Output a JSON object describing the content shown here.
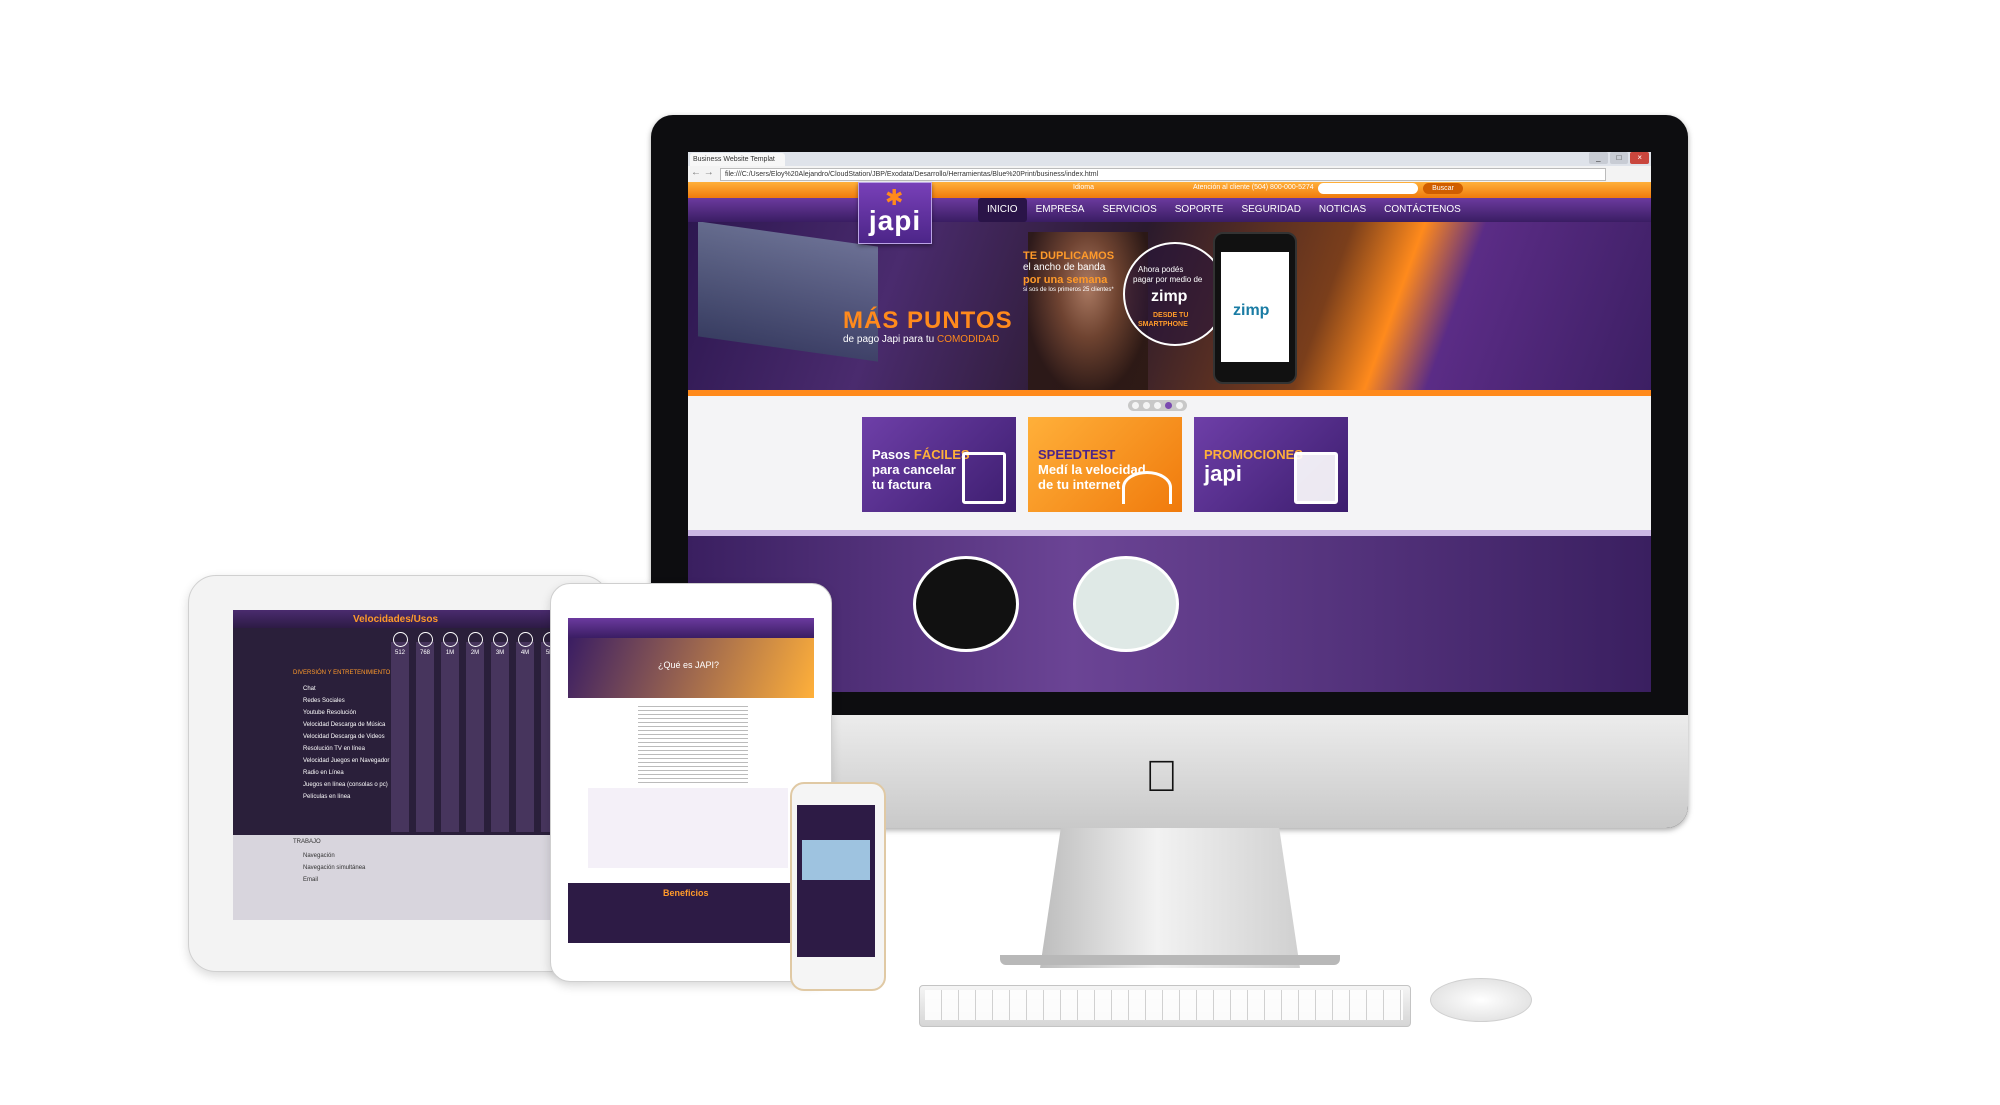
{
  "browser": {
    "tab_title": "Business Website Templat",
    "url": "file:///C:/Users/Eloy%20Alejandro/CloudStation/JBP/Exodata/Desarrollo/Herramientas/Blue%20Print/business/index.html",
    "win_controls": [
      "_",
      "□",
      "×"
    ]
  },
  "site": {
    "top": {
      "lang_label": "Idioma",
      "phone_label": "Atención al cliente (504) 800-000-5274",
      "search_button": "Buscar"
    },
    "logo": "japi",
    "nav": [
      "INICIO",
      "EMPRESA",
      "SERVICIOS",
      "SOPORTE",
      "SEGURIDAD",
      "NOTICIAS",
      "CONTÁCTENOS"
    ],
    "hero": {
      "title": "MÁS PUNTOS",
      "subtitle_prefix": "de pago Japi para tu ",
      "subtitle_highlight": "COMODIDAD",
      "dup1": "TE DUPLICAMOS",
      "dup2": "el ancho de banda",
      "dup3": "por una semana",
      "dup4": "si sos de los primeros 25 clientes*",
      "circle1": "Ahora podés",
      "circle2": "pagar por medio de",
      "circle3": "zimp",
      "circle4": "DESDE TU",
      "circle5": "SMARTPHONE",
      "phone_brand": "zimp"
    },
    "slider_dots": 5,
    "promos": [
      {
        "l1a": "Pasos ",
        "l1b": "FÁCILES",
        "l2": "para cancelar",
        "l3": "tu factura"
      },
      {
        "l1": "SPEEDTEST",
        "l2": "Medí la velocidad",
        "l3": "de tu internet"
      },
      {
        "l1": "PROMOCIONES",
        "l2": "japi"
      }
    ]
  },
  "tablet_landscape": {
    "title": "Velocidades/Usos",
    "category": "DIVERSIÓN Y ENTRETENIMIENTO",
    "columns": [
      "512",
      "768",
      "1M",
      "2M",
      "3M",
      "4M",
      "5M"
    ],
    "rows": [
      "Chat",
      "Redes Sociales",
      "Youtube Resolución",
      "Velocidad Descarga de Música",
      "Velocidad Descarga de Videos",
      "Resolución TV en línea",
      "Velocidad Juegos en Navegador",
      "Radio en Línea",
      "Juegos en línea (consolas o pc)",
      "Películas en línea"
    ],
    "work_title": "TRABAJO",
    "work_rows": [
      "Navegación",
      "Navegación simultánea",
      "Email"
    ]
  },
  "tablet_portrait": {
    "question": "¿Qué es JAPI?",
    "benefits": "Beneficios"
  },
  "apple_logo": ""
}
